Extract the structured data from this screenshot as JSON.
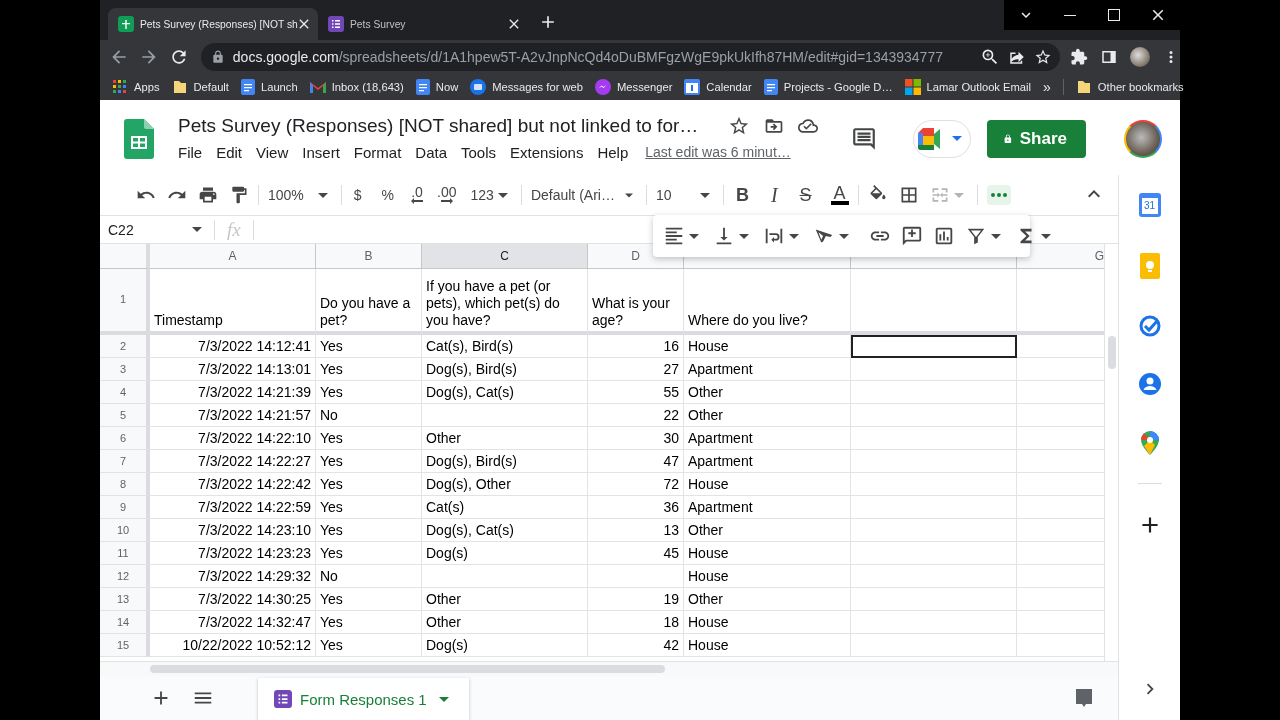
{
  "browser": {
    "tabs": [
      {
        "title": "Pets Survey (Responses) [NOT sh",
        "kind": "sheets",
        "selected": true
      },
      {
        "title": "Pets Survey",
        "kind": "forms",
        "selected": false
      }
    ],
    "address": {
      "host": "docs.google.com",
      "path": "/spreadsheets/d/1A1hpew5T-A2vJnpNcQd4oDuBMFgzWgE9pkUkIfh87HM/edit#gid=1343934777"
    },
    "bookmarks": [
      {
        "label": "Apps",
        "kind": "apps"
      },
      {
        "label": "Default",
        "kind": "folder"
      },
      {
        "label": "Launch",
        "kind": "doc"
      },
      {
        "label": "Inbox (18,643)",
        "kind": "mail"
      },
      {
        "label": "Now",
        "kind": "doc"
      },
      {
        "label": "Messages for web",
        "kind": "messages"
      },
      {
        "label": "Messenger",
        "kind": "messenger"
      },
      {
        "label": "Calendar",
        "kind": "calendar"
      },
      {
        "label": "Projects - Google D…",
        "kind": "doc"
      },
      {
        "label": "Lamar Outlook Email",
        "kind": "windows"
      }
    ],
    "overflow": "»",
    "other_bookmarks": "Other bookmarks"
  },
  "document": {
    "title": "Pets Survey (Responses) [NOT shared] but not linked to for…",
    "menu": [
      "File",
      "Edit",
      "View",
      "Insert",
      "Format",
      "Data",
      "Tools",
      "Extensions",
      "Help"
    ],
    "last_edit": "Last edit was 6 minut…",
    "share_label": "Share"
  },
  "toolbar": {
    "groups": [
      [
        {
          "kind": "undo"
        },
        {
          "kind": "redo"
        },
        {
          "kind": "print"
        },
        {
          "kind": "paint_format"
        }
      ],
      [
        {
          "kind": "zoom",
          "label": "100%"
        }
      ],
      [
        {
          "kind": "currency",
          "label": "$"
        },
        {
          "kind": "percent",
          "label": "%"
        },
        {
          "kind": "decrease_decimals",
          "label": ".0"
        },
        {
          "kind": "increase_decimals",
          "label": ".00"
        },
        {
          "kind": "number_formats",
          "label": "123"
        }
      ],
      [
        {
          "kind": "font",
          "label": "Default (Ari…"
        }
      ],
      [
        {
          "kind": "font_size",
          "label": "10"
        }
      ],
      [
        {
          "kind": "bold",
          "label": "B"
        },
        {
          "kind": "italic",
          "label": "I"
        },
        {
          "kind": "strikethrough",
          "label": "S"
        },
        {
          "kind": "text_color",
          "label": "A"
        }
      ],
      [
        {
          "kind": "fill_color",
          "disabled": false
        },
        {
          "kind": "borders",
          "disabled": false
        },
        {
          "kind": "merge",
          "disabled": true
        }
      ],
      [
        {
          "kind": "more",
          "selected": true
        }
      ]
    ]
  },
  "format_menu": {
    "groups": [
      [
        {
          "kind": "align"
        },
        {
          "kind": "vertical_align"
        },
        {
          "kind": "wrap"
        },
        {
          "kind": "rotate"
        }
      ],
      [
        {
          "kind": "link"
        },
        {
          "kind": "comment"
        },
        {
          "kind": "chart"
        },
        {
          "kind": "filter"
        },
        {
          "kind": "functions"
        }
      ]
    ]
  },
  "formula_bar": {
    "cell_ref": "C22",
    "fx": "fx"
  },
  "sheet": {
    "columns": [
      {
        "letter": "A",
        "selected": false
      },
      {
        "letter": "B",
        "selected": false
      },
      {
        "letter": "C",
        "selected": true
      },
      {
        "letter": "D",
        "selected": false
      },
      {
        "letter": "G",
        "selected": false
      }
    ],
    "header_row": {
      "number": "1",
      "cells": [
        "Timestamp",
        "Do you have a pet?",
        "If you have a pet (or pets), which pet(s) do you have?",
        "What is your age?",
        "Where do you live?"
      ]
    },
    "rows": [
      {
        "number": "2",
        "selected": true,
        "cells": [
          "7/3/2022 14:12:41",
          "Yes",
          "Cat(s), Bird(s)",
          "16",
          "House"
        ]
      },
      {
        "number": "3",
        "selected": false,
        "cells": [
          "7/3/2022 14:13:01",
          "Yes",
          "Dog(s), Bird(s)",
          "27",
          "Apartment"
        ]
      },
      {
        "number": "4",
        "selected": false,
        "cells": [
          "7/3/2022 14:21:39",
          "Yes",
          "Dog(s), Cat(s)",
          "55",
          "Other"
        ]
      },
      {
        "number": "5",
        "selected": false,
        "cells": [
          "7/3/2022 14:21:57",
          "No",
          null,
          "22",
          "Other"
        ]
      },
      {
        "number": "6",
        "selected": false,
        "cells": [
          "7/3/2022 14:22:10",
          "Yes",
          "Other",
          "30",
          "Apartment"
        ]
      },
      {
        "number": "7",
        "selected": false,
        "cells": [
          "7/3/2022 14:22:27",
          "Yes",
          "Dog(s), Bird(s)",
          "47",
          "Apartment"
        ]
      },
      {
        "number": "8",
        "selected": false,
        "cells": [
          "7/3/2022 14:22:42",
          "Yes",
          "Dog(s), Other",
          "72",
          "House"
        ]
      },
      {
        "number": "9",
        "selected": false,
        "cells": [
          "7/3/2022 14:22:59",
          "Yes",
          "Cat(s)",
          "36",
          "Apartment"
        ]
      },
      {
        "number": "10",
        "selected": false,
        "cells": [
          "7/3/2022 14:23:10",
          "Yes",
          "Dog(s), Cat(s)",
          "13",
          "Other"
        ]
      },
      {
        "number": "11",
        "selected": false,
        "cells": [
          "7/3/2022 14:23:23",
          "Yes",
          "Dog(s)",
          "45",
          "House"
        ]
      },
      {
        "number": "12",
        "selected": false,
        "cells": [
          "7/3/2022 14:29:32",
          "No",
          null,
          null,
          "House"
        ]
      },
      {
        "number": "13",
        "selected": false,
        "cells": [
          "7/3/2022 14:30:25",
          "Yes",
          "Other",
          "19",
          "Other"
        ]
      },
      {
        "number": "14",
        "selected": false,
        "cells": [
          "7/3/2022 14:32:47",
          "Yes",
          "Other",
          "18",
          "House"
        ]
      },
      {
        "number": "15",
        "selected": false,
        "cells": [
          "10/22/2022 10:52:12",
          "Yes",
          "Dog(s)",
          "42",
          "House"
        ]
      }
    ]
  },
  "sheet_tabs": [
    {
      "label": "Form Responses 1",
      "selected": true
    }
  ],
  "side_panel": {
    "calendar_day": "31"
  }
}
